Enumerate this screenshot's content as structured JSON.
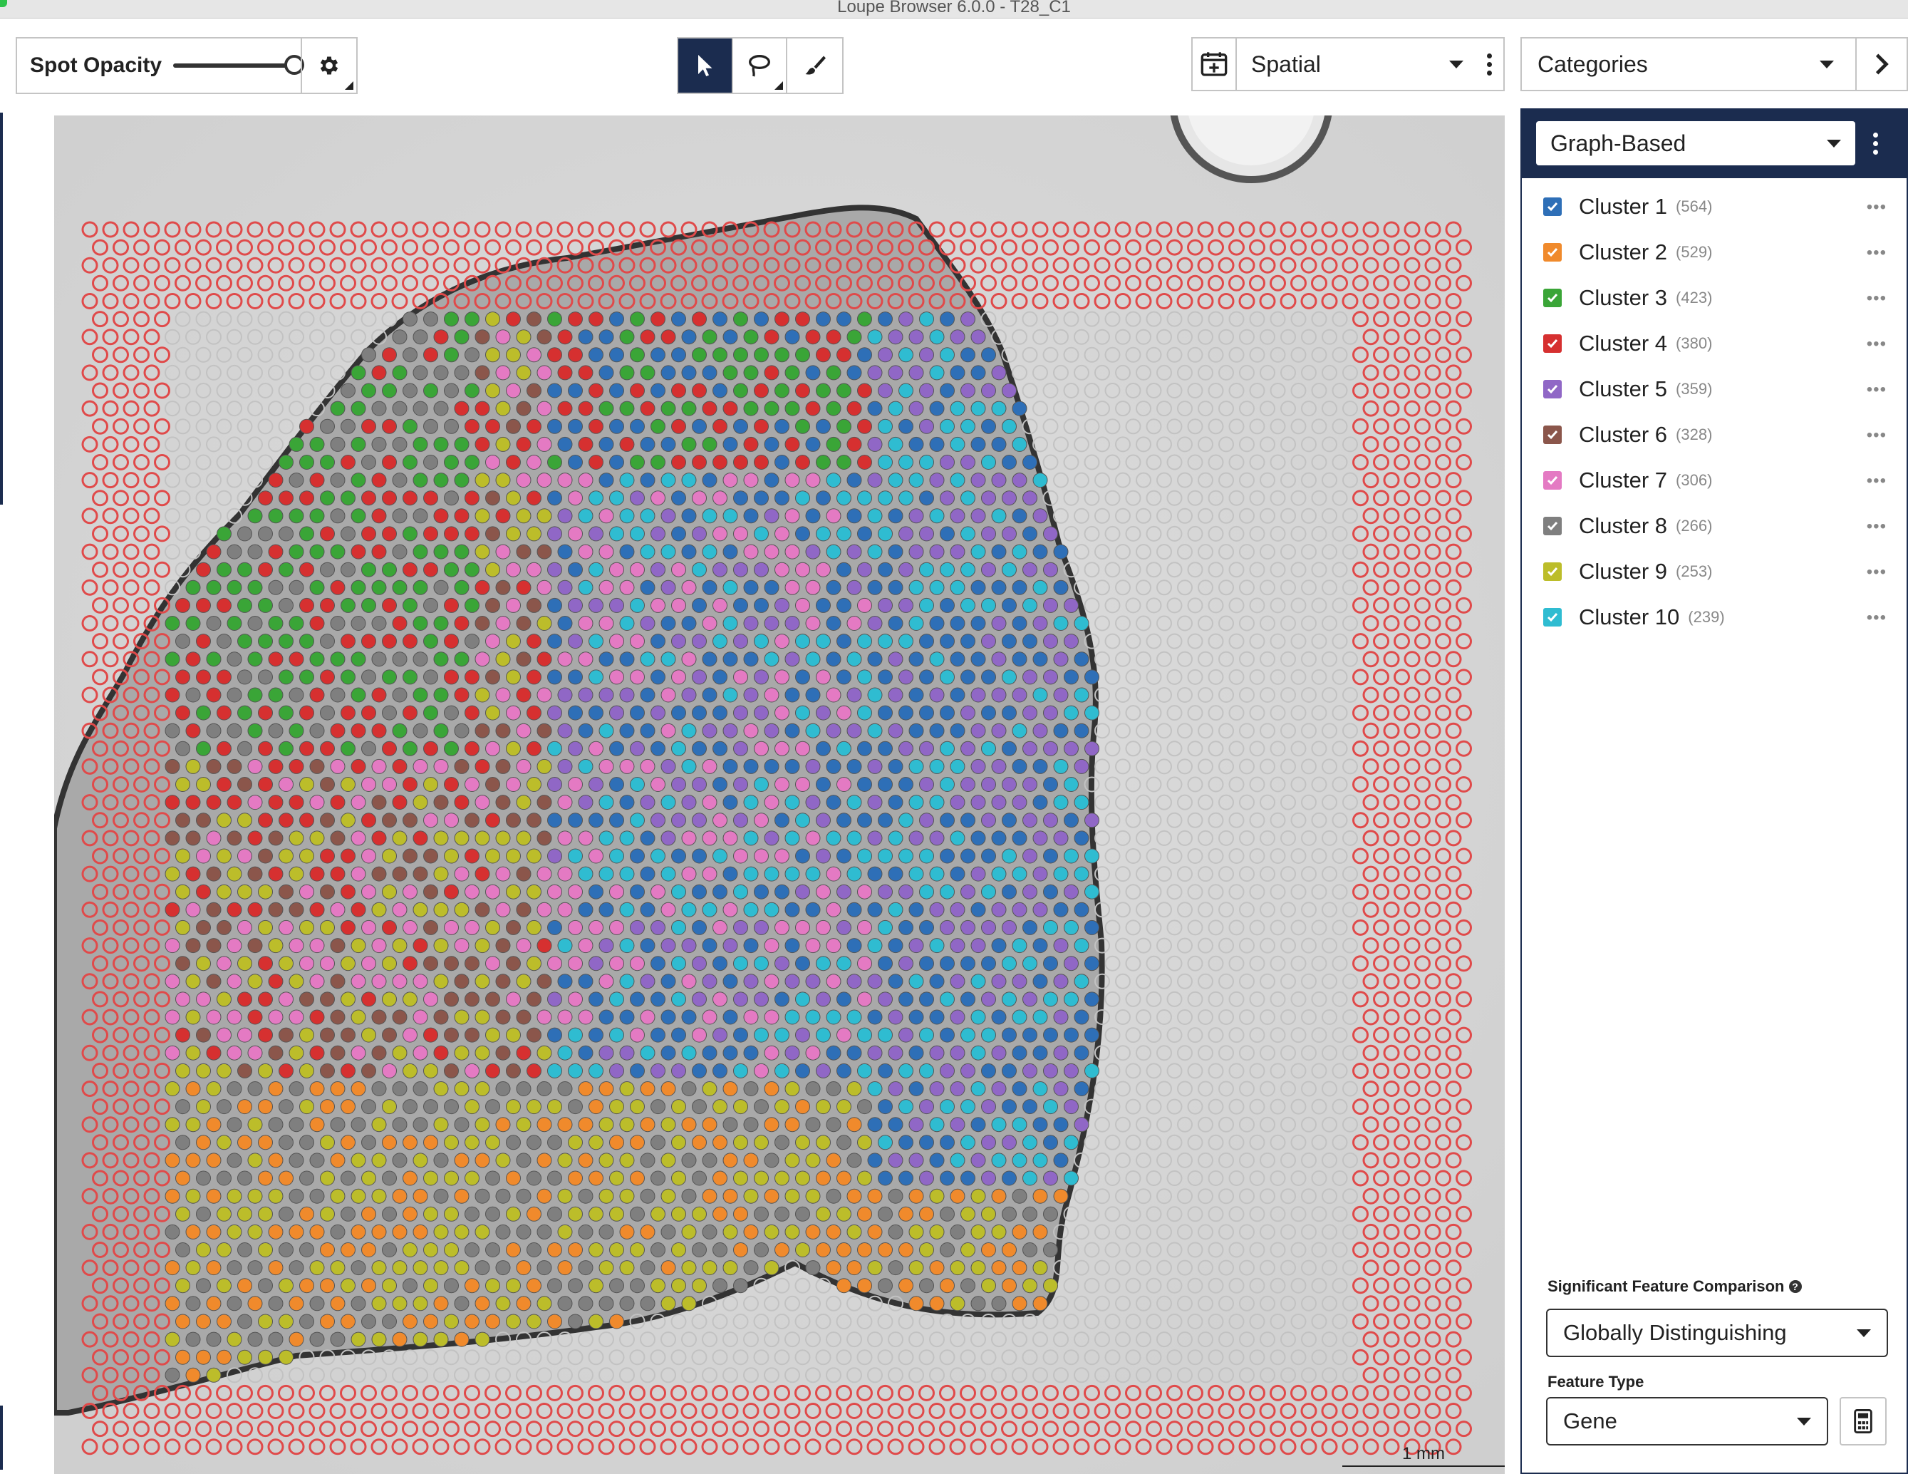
{
  "window": {
    "title": "Loupe Browser 6.0.0 - T28_C1"
  },
  "toolbar": {
    "spot_opacity_label": "Spot Opacity",
    "spot_opacity_value": 1.0,
    "tools": [
      {
        "name": "select-tool",
        "icon": "pointer-icon",
        "active": true
      },
      {
        "name": "lasso-tool",
        "icon": "lasso-icon",
        "active": false
      },
      {
        "name": "brush-tool",
        "icon": "brush-icon",
        "active": false
      }
    ],
    "view_label": "Spatial",
    "categories_label": "Categories"
  },
  "canvas": {
    "scale_label": "1 mm"
  },
  "panel": {
    "clustering_label": "Graph-Based",
    "clusters": [
      {
        "label": "Cluster 1",
        "count": "(564)",
        "color": "#2e6fb7"
      },
      {
        "label": "Cluster 2",
        "count": "(529)",
        "color": "#f08a2c"
      },
      {
        "label": "Cluster 3",
        "count": "(423)",
        "color": "#3aa537"
      },
      {
        "label": "Cluster 4",
        "count": "(380)",
        "color": "#d63030"
      },
      {
        "label": "Cluster 5",
        "count": "(359)",
        "color": "#9067c6"
      },
      {
        "label": "Cluster 6",
        "count": "(328)",
        "color": "#8b564b"
      },
      {
        "label": "Cluster 7",
        "count": "(306)",
        "color": "#e47ac3"
      },
      {
        "label": "Cluster 8",
        "count": "(266)",
        "color": "#7f7f7f"
      },
      {
        "label": "Cluster 9",
        "count": "(253)",
        "color": "#bcbd2a"
      },
      {
        "label": "Cluster 10",
        "count": "(239)",
        "color": "#2fbcd1"
      }
    ],
    "sfc_label": "Significant Feature Comparison",
    "sfc_value": "Globally Distinguishing",
    "feature_type_label": "Feature Type",
    "feature_type_value": "Gene"
  },
  "colors": {
    "navy": "#1b2c4f",
    "fiducial_red": "#e04a4a",
    "background_spot": "#c2c2c2"
  }
}
